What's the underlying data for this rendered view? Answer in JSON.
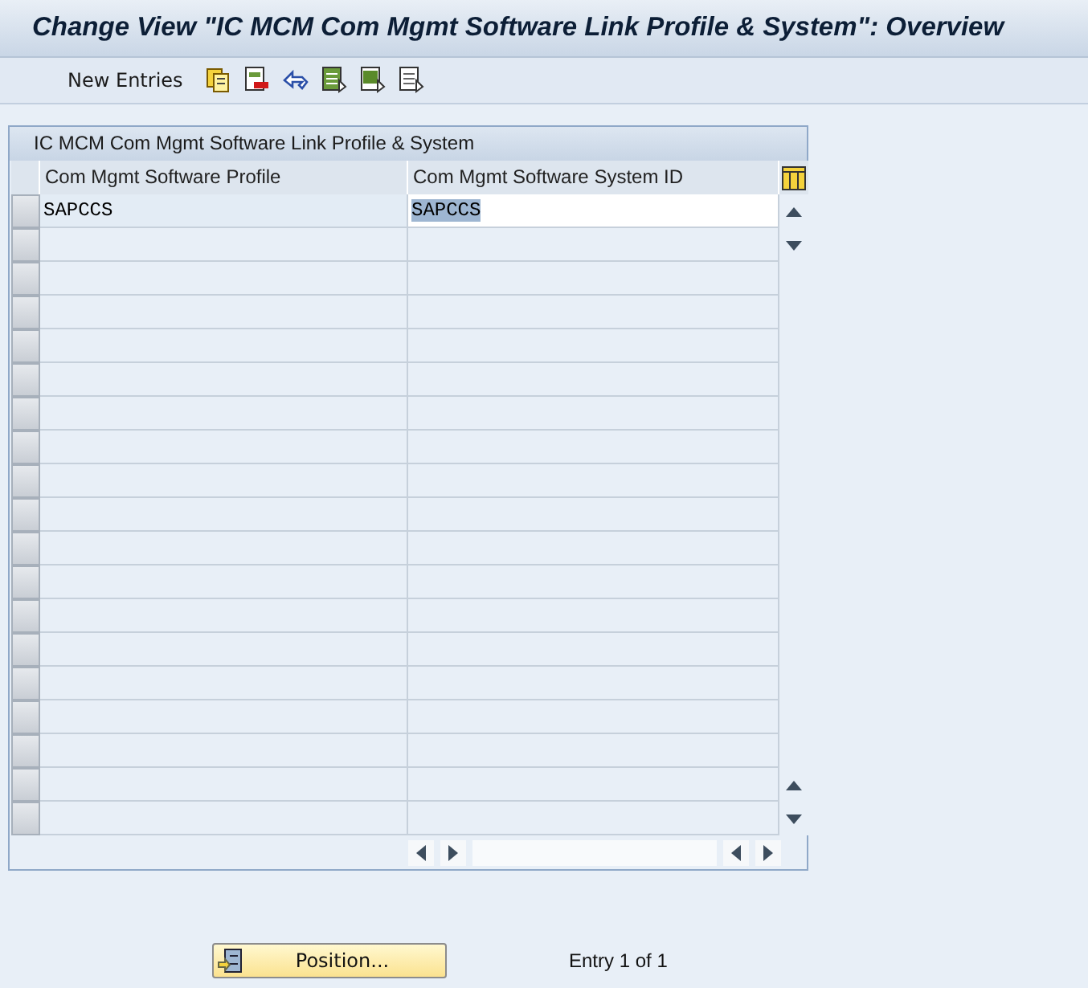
{
  "window": {
    "title": "Change View \"IC MCM Com Mgmt Software Link Profile & System\": Overview"
  },
  "toolbar": {
    "buttons": [
      {
        "kind": "text",
        "label": "New Entries"
      },
      {
        "kind": "copy"
      },
      {
        "kind": "delete"
      },
      {
        "kind": "undo"
      },
      {
        "kind": "select-all"
      },
      {
        "kind": "select-block"
      },
      {
        "kind": "deselect-all"
      }
    ]
  },
  "table": {
    "title": "IC MCM Com Mgmt Software Link Profile & System",
    "columns": [
      "Com Mgmt Software Profile",
      "Com Mgmt Software System ID"
    ],
    "rows": [
      {
        "cells": [
          {
            "kind": "display",
            "text": "SAPCCS",
            "highlighted": false
          },
          {
            "kind": "input",
            "text": "SAPCCS",
            "highlighted": true
          }
        ]
      }
    ]
  },
  "footer": {
    "position_button": "Position...",
    "entry_info": "Entry 1 of 1"
  }
}
